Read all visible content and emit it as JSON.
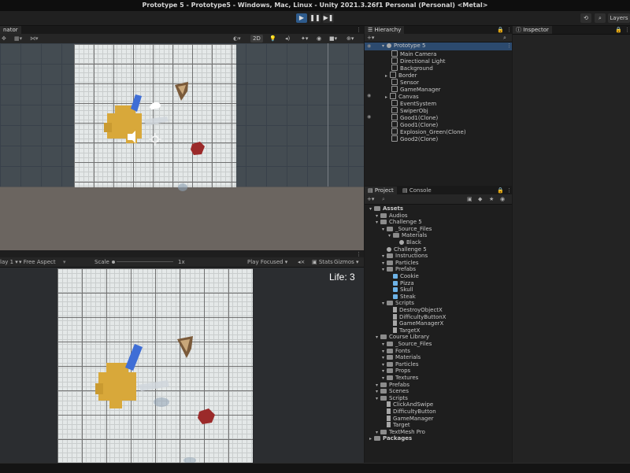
{
  "window": {
    "title": "Prototype 5 - Prototype5 - Windows, Mac, Linux - Unity 2021.3.26f1 Personal (Personal) <Metal>"
  },
  "toolbar": {
    "play": "▶",
    "pause": "❚❚",
    "step": "▶❚",
    "history": "⟲",
    "search": "⌕",
    "layers": "Layers"
  },
  "scene": {
    "tab": "nator",
    "mode_2d": "2D"
  },
  "game": {
    "display": "lay 1",
    "aspect": "Free Aspect",
    "scale_label": "Scale",
    "scale_value": "1x",
    "play_mode": "Play Focused",
    "stats": "Stats",
    "gizmos": "Gizmos",
    "life_text": "Life: 3"
  },
  "hierarchy": {
    "tab": "Hierarchy",
    "root": "Prototype 5",
    "items": [
      "Main Camera",
      "Directional Light",
      "Background",
      "Border",
      "Sensor",
      "GameManager",
      "Canvas",
      "EventSystem",
      "SwiperObj",
      "Good1(Clone)",
      "Good1(Clone)",
      "Explosion_Green(Clone)",
      "Good2(Clone)"
    ]
  },
  "inspector": {
    "tab": "Inspector"
  },
  "project": {
    "tabs": [
      "Project",
      "Console"
    ],
    "assets_root": "Assets",
    "tree": [
      {
        "label": "Audios",
        "depth": 1,
        "kind": "folder"
      },
      {
        "label": "Challenge 5",
        "depth": 1,
        "kind": "folder"
      },
      {
        "label": "_Source_Files",
        "depth": 2,
        "kind": "folder"
      },
      {
        "label": "Materials",
        "depth": 3,
        "kind": "folder"
      },
      {
        "label": "Black",
        "depth": 4,
        "kind": "material"
      },
      {
        "label": "Challenge 5",
        "depth": 2,
        "kind": "scene"
      },
      {
        "label": "Instructions",
        "depth": 2,
        "kind": "folder"
      },
      {
        "label": "Particles",
        "depth": 2,
        "kind": "folder"
      },
      {
        "label": "Prefabs",
        "depth": 2,
        "kind": "folder"
      },
      {
        "label": "Cookie",
        "depth": 3,
        "kind": "prefab"
      },
      {
        "label": "Pizza",
        "depth": 3,
        "kind": "prefab"
      },
      {
        "label": "Skull",
        "depth": 3,
        "kind": "prefab"
      },
      {
        "label": "Steak",
        "depth": 3,
        "kind": "prefab"
      },
      {
        "label": "Scripts",
        "depth": 2,
        "kind": "folder"
      },
      {
        "label": "DestroyObjectX",
        "depth": 3,
        "kind": "file"
      },
      {
        "label": "DifficultyButtonX",
        "depth": 3,
        "kind": "file"
      },
      {
        "label": "GameManagerX",
        "depth": 3,
        "kind": "file"
      },
      {
        "label": "TargetX",
        "depth": 3,
        "kind": "file"
      },
      {
        "label": "Course Library",
        "depth": 1,
        "kind": "folder"
      },
      {
        "label": "_Source_Files",
        "depth": 2,
        "kind": "folder"
      },
      {
        "label": "Fonts",
        "depth": 2,
        "kind": "folder"
      },
      {
        "label": "Materials",
        "depth": 2,
        "kind": "folder"
      },
      {
        "label": "Particles",
        "depth": 2,
        "kind": "folder"
      },
      {
        "label": "Props",
        "depth": 2,
        "kind": "folder"
      },
      {
        "label": "Textures",
        "depth": 2,
        "kind": "folder"
      },
      {
        "label": "Prefabs",
        "depth": 1,
        "kind": "folder"
      },
      {
        "label": "Scenes",
        "depth": 1,
        "kind": "folder"
      },
      {
        "label": "Scripts",
        "depth": 1,
        "kind": "folder"
      },
      {
        "label": "ClickAndSwipe",
        "depth": 2,
        "kind": "file"
      },
      {
        "label": "DifficultyButton",
        "depth": 2,
        "kind": "file"
      },
      {
        "label": "GameManager",
        "depth": 2,
        "kind": "file"
      },
      {
        "label": "Target",
        "depth": 2,
        "kind": "file"
      },
      {
        "label": "TextMesh Pro",
        "depth": 1,
        "kind": "folder"
      }
    ],
    "packages": "Packages"
  },
  "colors": {
    "accent": "#2e5b8c",
    "panel": "#1e1e1e",
    "background": "#191919",
    "cookie": "#d8a83a",
    "skull": "#9b2a2a",
    "blue": "#3f6ed6"
  }
}
